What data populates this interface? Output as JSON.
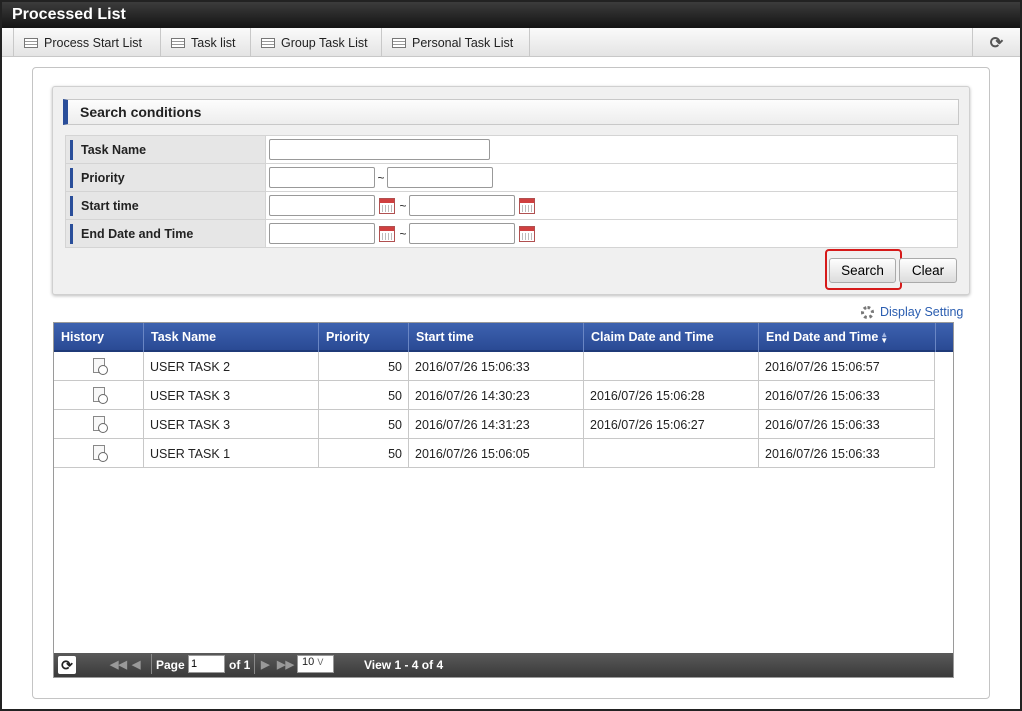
{
  "window": {
    "title": "Processed List"
  },
  "tabs": [
    {
      "label": "Process Start List"
    },
    {
      "label": "Task list"
    },
    {
      "label": "Group Task List"
    },
    {
      "label": "Personal Task List"
    }
  ],
  "search": {
    "header": "Search conditions",
    "fields": [
      {
        "label": "Task Name",
        "value": ""
      },
      {
        "label": "Priority",
        "from": "",
        "to": ""
      },
      {
        "label": "Start time",
        "from": "",
        "to": ""
      },
      {
        "label": "End Date and Time",
        "from": "",
        "to": ""
      }
    ],
    "range_separator": "~",
    "search_button": "Search",
    "clear_button": "Clear"
  },
  "display_setting": "Display Setting",
  "grid": {
    "columns": [
      "History",
      "Task Name",
      "Priority",
      "Start time",
      "Claim Date and Time",
      "End Date and Time"
    ],
    "sorted_column": "End Date and Time",
    "rows": [
      {
        "task_name": "USER TASK 2",
        "priority": "50",
        "start_time": "2016/07/26 15:06:33",
        "claim_time": "",
        "end_time": "2016/07/26 15:06:57"
      },
      {
        "task_name": "USER TASK 3",
        "priority": "50",
        "start_time": "2016/07/26 14:30:23",
        "claim_time": "2016/07/26 15:06:28",
        "end_time": "2016/07/26 15:06:33"
      },
      {
        "task_name": "USER TASK 3",
        "priority": "50",
        "start_time": "2016/07/26 14:31:23",
        "claim_time": "2016/07/26 15:06:27",
        "end_time": "2016/07/26 15:06:33"
      },
      {
        "task_name": "USER TASK 1",
        "priority": "50",
        "start_time": "2016/07/26 15:06:05",
        "claim_time": "",
        "end_time": "2016/07/26 15:06:33"
      }
    ]
  },
  "pager": {
    "page_label": "Page",
    "page_value": "1",
    "of_label": "of 1",
    "rows_per_page": "10",
    "view_info": "View 1 - 4 of 4"
  },
  "colors": {
    "header_blue": "#2a4a94",
    "accent_bar": "#2a4e9a",
    "highlight_red": "#d61a1a",
    "link": "#2a5db0"
  },
  "icons": [
    "list-icon",
    "refresh-icon",
    "calendar-icon",
    "gear-icon",
    "history-icon",
    "sort-icon",
    "first-page-icon",
    "prev-page-icon",
    "next-page-icon",
    "last-page-icon"
  ]
}
